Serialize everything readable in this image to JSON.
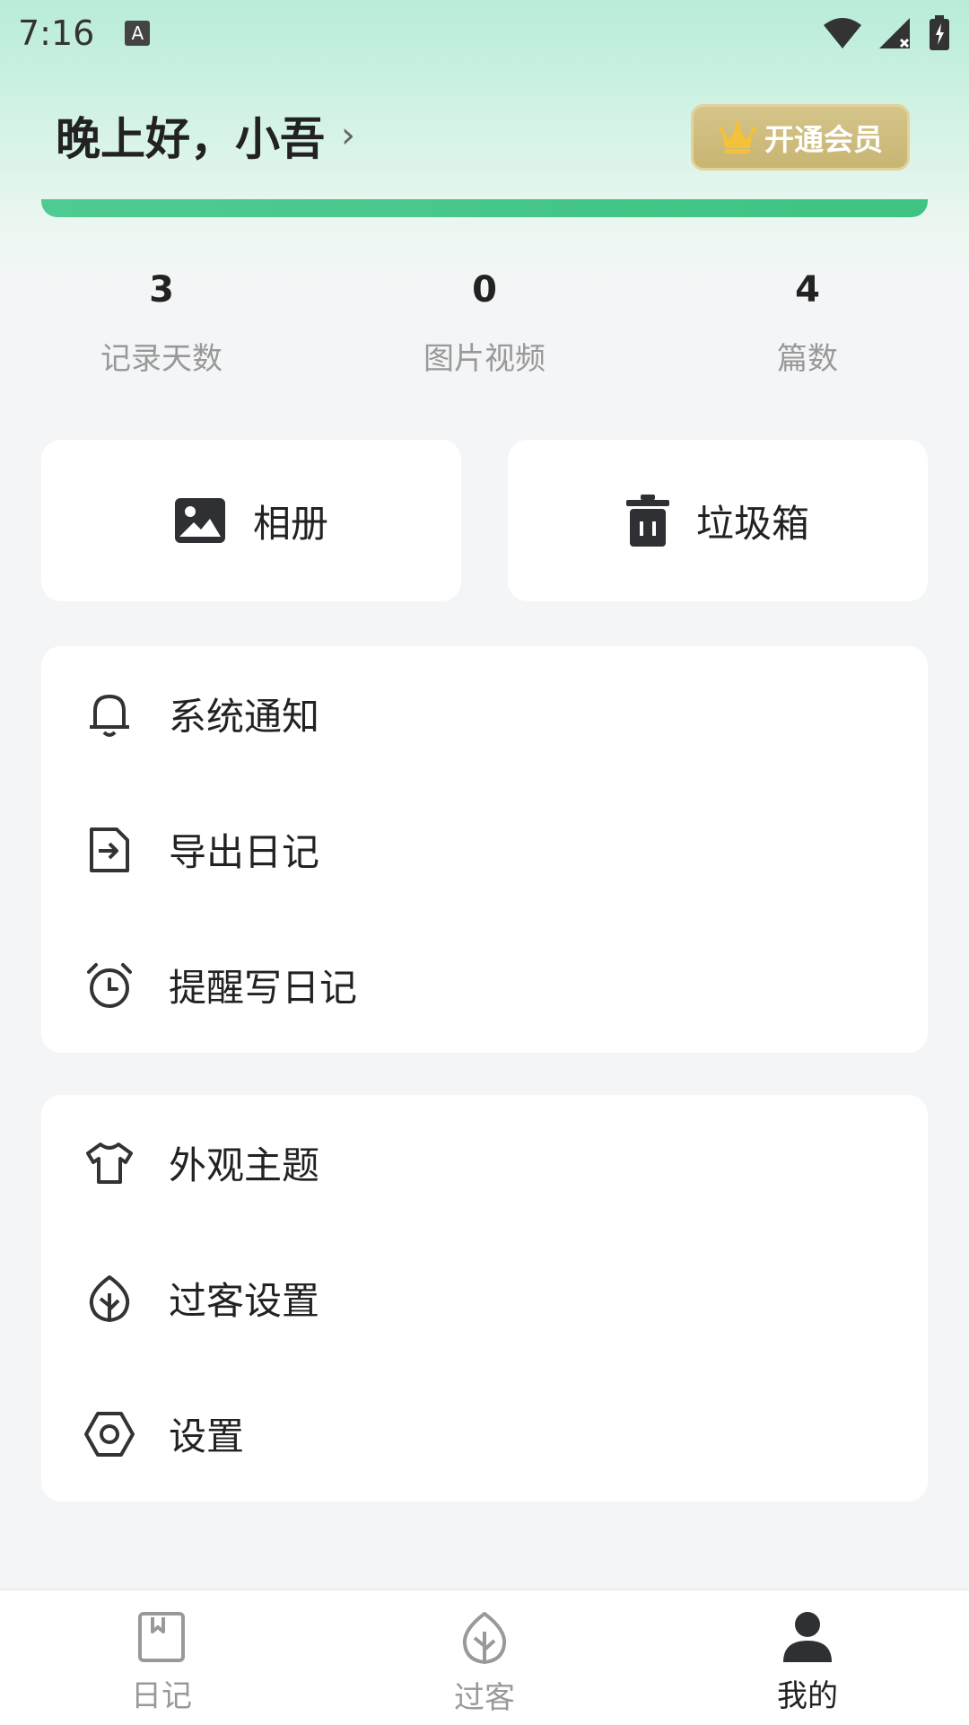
{
  "status_bar": {
    "time": "7:16",
    "notification_badge": "A"
  },
  "header": {
    "greeting": "晚上好，小吾",
    "chevron": "›",
    "vip_label": "开通会员"
  },
  "stats": [
    {
      "value": "3",
      "label": "记录天数"
    },
    {
      "value": "0",
      "label": "图片视频"
    },
    {
      "value": "4",
      "label": "篇数"
    }
  ],
  "quick_actions": {
    "album": "相册",
    "trash": "垃圾箱"
  },
  "menu_group_1": [
    {
      "label": "系统通知",
      "icon": "bell-icon"
    },
    {
      "label": "导出日记",
      "icon": "export-icon"
    },
    {
      "label": "提醒写日记",
      "icon": "alarm-clock-icon"
    }
  ],
  "menu_group_2": [
    {
      "label": "外观主题",
      "icon": "shirt-icon"
    },
    {
      "label": "过客设置",
      "icon": "leaf-icon"
    },
    {
      "label": "设置",
      "icon": "hexagon-settings-icon"
    }
  ],
  "tabs": [
    {
      "label": "日记",
      "icon": "diary-icon",
      "active": false
    },
    {
      "label": "过客",
      "icon": "leaf-icon",
      "active": false
    },
    {
      "label": "我的",
      "icon": "person-icon",
      "active": true
    }
  ],
  "colors": {
    "accent_green": "#3ec382",
    "vip_gold": "#c8b572",
    "background": "#f4f5f7"
  }
}
